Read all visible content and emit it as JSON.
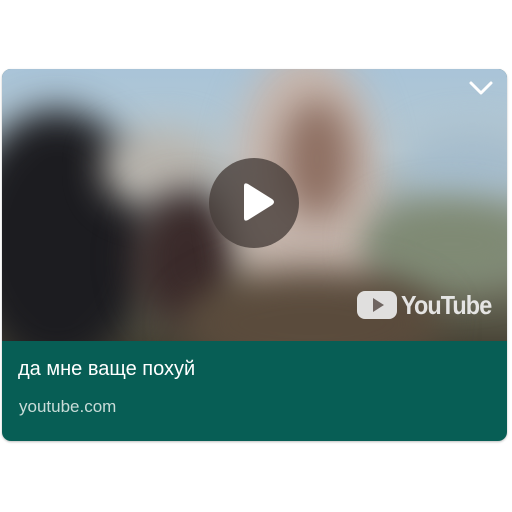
{
  "preview": {
    "title": "да мне ваще похуй",
    "domain": "youtube.com",
    "logo_text": "YouTube",
    "icons": {
      "play": "play-icon",
      "expand": "chevron-down-icon",
      "logo": "youtube-logo-icon"
    }
  },
  "colors": {
    "card_background": "#075e55",
    "title_text": "#ffffff",
    "domain_text": "#c9dcd8"
  }
}
